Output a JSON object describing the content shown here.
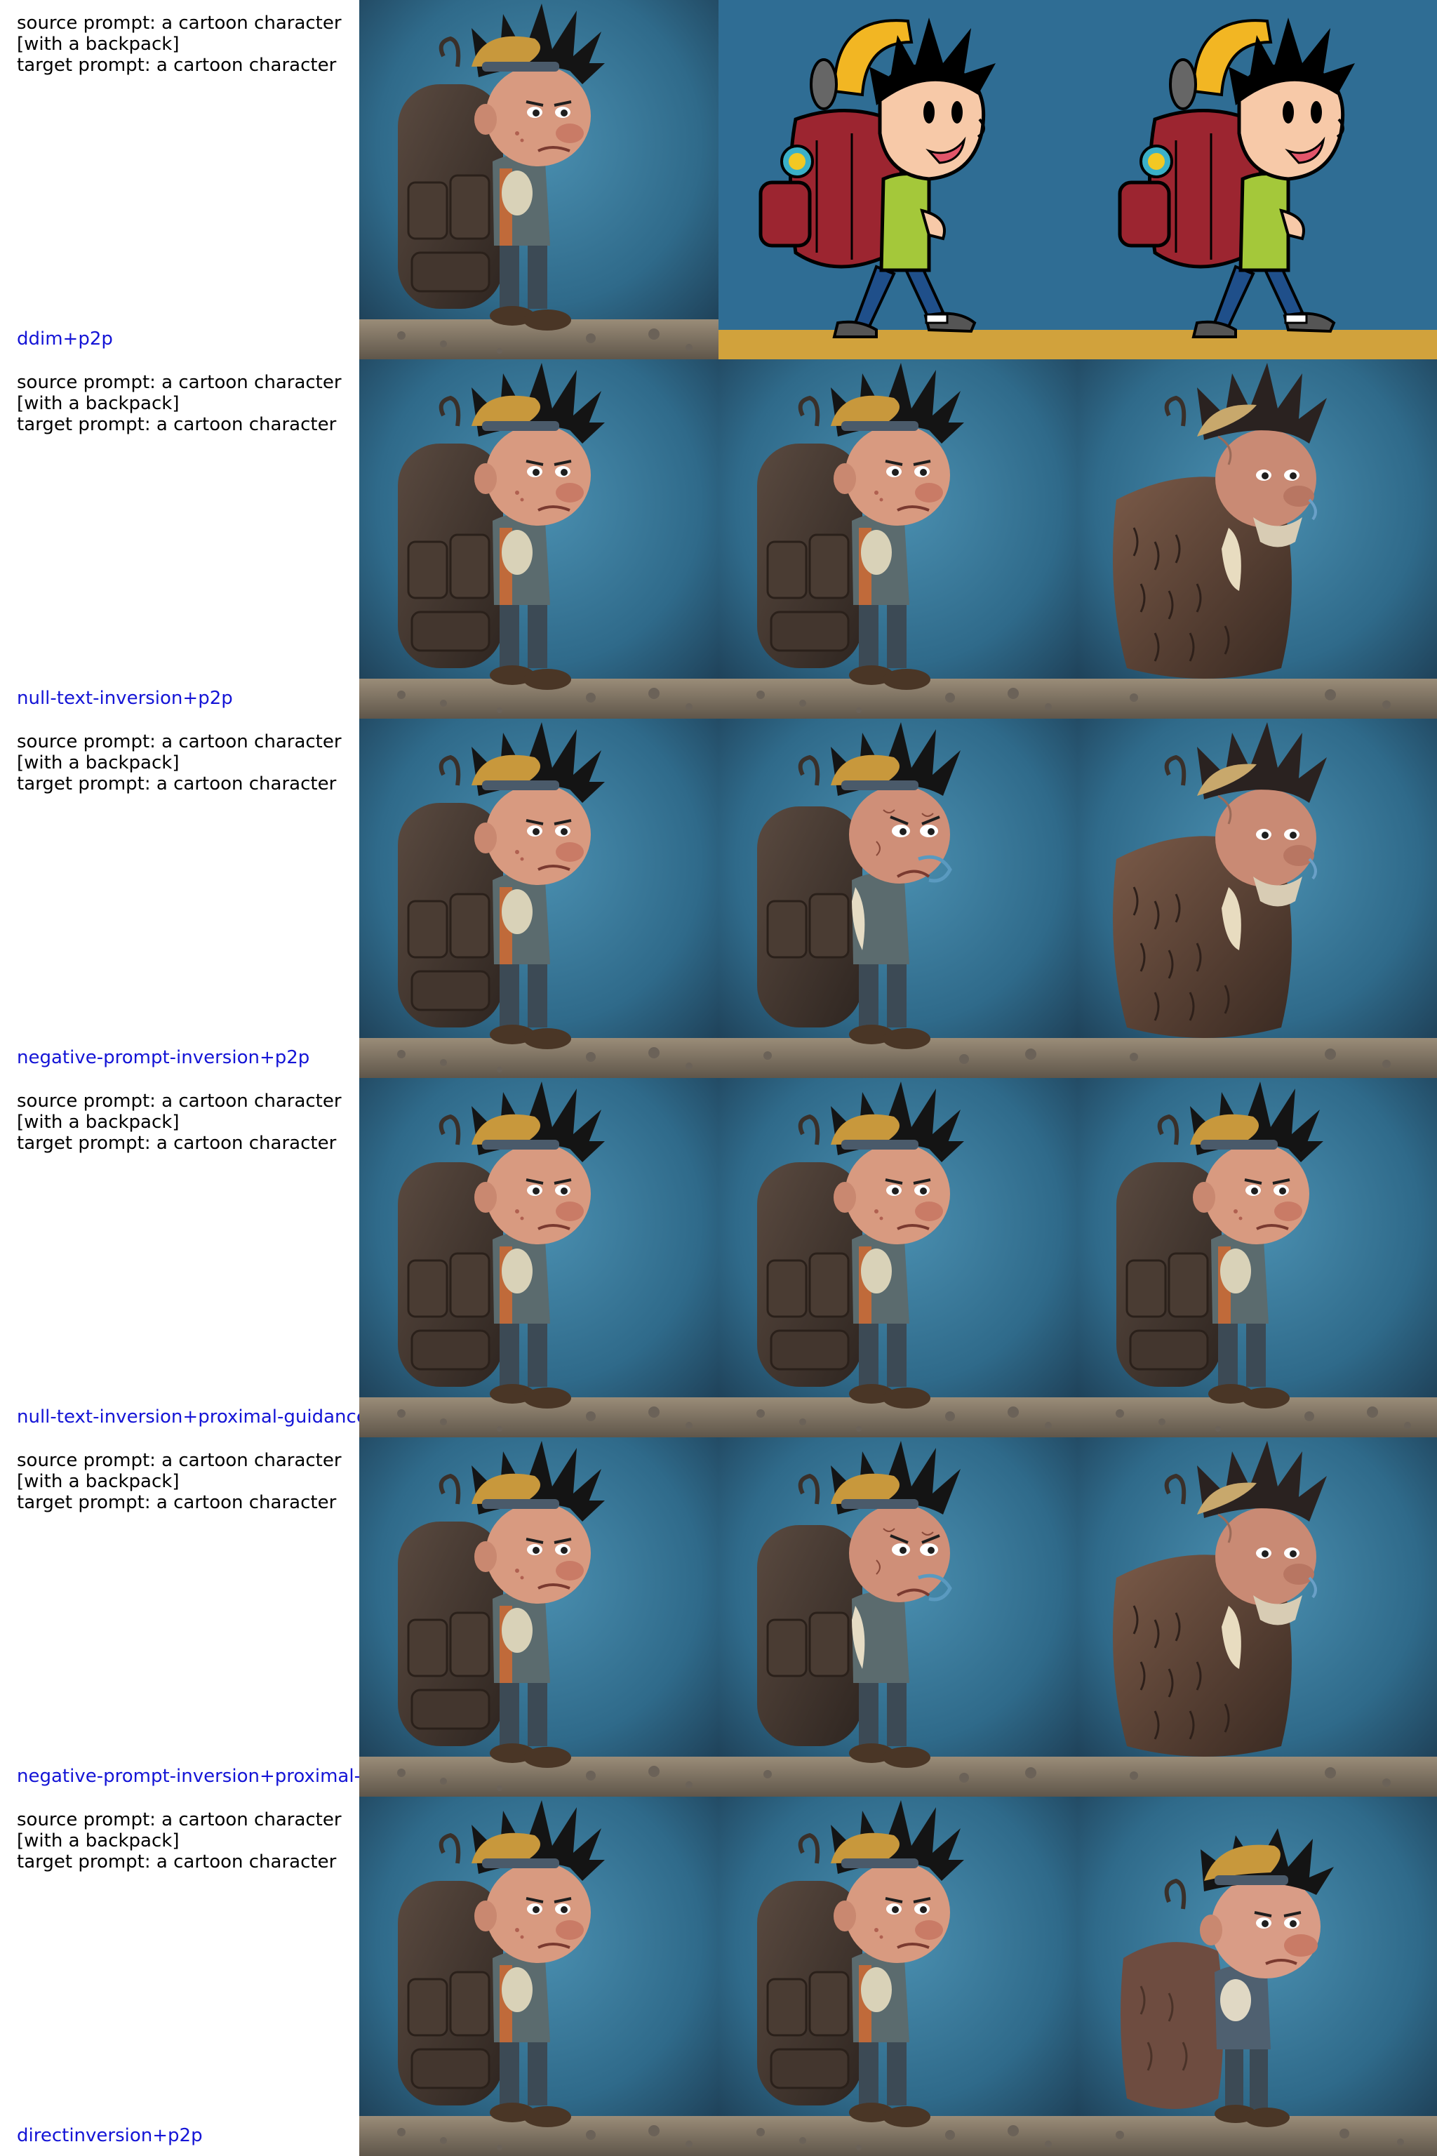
{
  "colors": {
    "method_label": "#1414d6",
    "text": "#000000",
    "backdrop_top": "#2f6a8a",
    "backdrop_bottom": "#1e3e54",
    "ground": "#8a7d6b"
  },
  "rows": [
    {
      "source_prompt_line1": "source prompt: a cartoon character",
      "source_prompt_line2": "[with a backpack]",
      "target_prompt": "target prompt: a cartoon character",
      "method": "ddim+p2p",
      "images": [
        {
          "icon": "realistic-boy-with-backpack-image"
        },
        {
          "icon": "flat-cartoon-boy-with-red-backpack-image"
        },
        {
          "icon": "flat-cartoon-boy-with-red-backpack-image"
        }
      ]
    },
    {
      "source_prompt_line1": "source prompt: a cartoon character",
      "source_prompt_line2": "[with a backpack]",
      "target_prompt": "target prompt: a cartoon character",
      "method": "null-text-inversion+p2p",
      "images": [
        {
          "icon": "realistic-boy-with-backpack-image"
        },
        {
          "icon": "realistic-boy-with-backpack-image"
        },
        {
          "icon": "furry-creature-image"
        }
      ]
    },
    {
      "source_prompt_line1": "source prompt: a cartoon character",
      "source_prompt_line2": "[with a backpack]",
      "target_prompt": "target prompt: a cartoon character",
      "method": "negative-prompt-inversion+p2p",
      "images": [
        {
          "icon": "realistic-boy-with-backpack-image"
        },
        {
          "icon": "distorted-boy-image"
        },
        {
          "icon": "furry-creature-image"
        }
      ]
    },
    {
      "source_prompt_line1": "source prompt: a cartoon character",
      "source_prompt_line2": "[with a backpack]",
      "target_prompt": "target prompt: a cartoon character",
      "method": "null-text-inversion+proximal-guidance",
      "images": [
        {
          "icon": "realistic-boy-with-backpack-image"
        },
        {
          "icon": "realistic-boy-with-backpack-image"
        },
        {
          "icon": "realistic-boy-with-backpack-image"
        }
      ]
    },
    {
      "source_prompt_line1": "source prompt: a cartoon character",
      "source_prompt_line2": "[with a backpack]",
      "target_prompt": "target prompt: a cartoon character",
      "method": "negative-prompt-inversion+proximal-guidance",
      "images": [
        {
          "icon": "realistic-boy-with-backpack-image"
        },
        {
          "icon": "distorted-boy-image"
        },
        {
          "icon": "furry-creature-image"
        }
      ]
    },
    {
      "source_prompt_line1": "source prompt: a cartoon character",
      "source_prompt_line2": "[with a backpack]",
      "target_prompt": "target prompt: a cartoon character",
      "method": "directinversion+p2p",
      "images": [
        {
          "icon": "realistic-boy-with-backpack-image"
        },
        {
          "icon": "realistic-boy-with-backpack-image"
        },
        {
          "icon": "realistic-boy-smaller-backpack-image"
        }
      ]
    }
  ]
}
